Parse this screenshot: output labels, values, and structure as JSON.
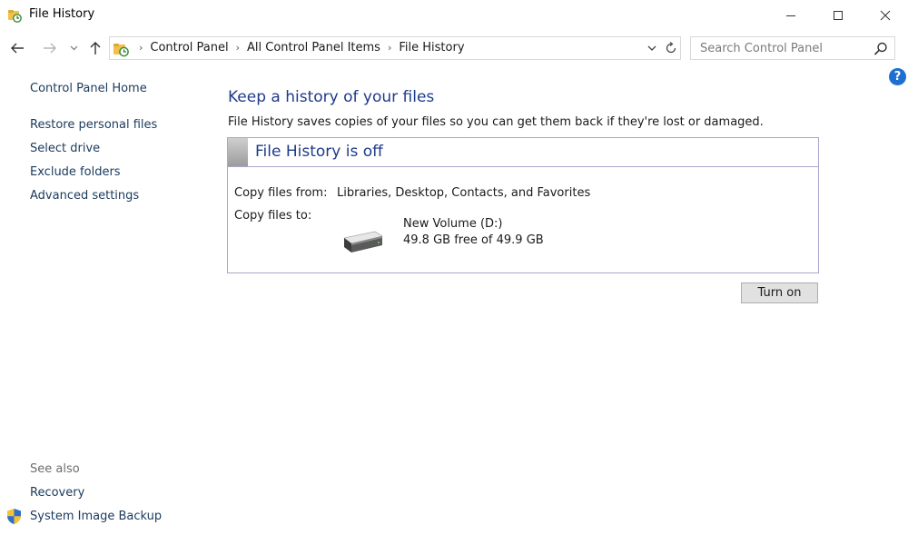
{
  "window": {
    "title": "File History",
    "controls": {
      "minimize_icon": "minimize-icon",
      "maximize_icon": "maximize-icon",
      "close_icon": "close-icon"
    }
  },
  "navigation": {
    "back_icon": "arrow-left-icon",
    "forward_icon": "arrow-right-icon",
    "recent_icon": "chevron-down-icon",
    "up_icon": "arrow-up-icon",
    "breadcrumbs": [
      "Control Panel",
      "All Control Panel Items",
      "File History"
    ],
    "refresh_icon": "refresh-icon",
    "search": {
      "placeholder": "Search Control Panel"
    }
  },
  "help_icon": "?",
  "sidebar": {
    "home_label": "Control Panel Home",
    "links": [
      "Restore personal files",
      "Select drive",
      "Exclude folders",
      "Advanced settings"
    ],
    "see_also_label": "See also",
    "see_also": [
      "Recovery",
      "System Image Backup"
    ]
  },
  "main": {
    "heading": "Keep a history of your files",
    "description": "File History saves copies of your files so you can get them back if they're lost or damaged.",
    "status": {
      "title": "File History is off",
      "copy_from_label": "Copy files from:",
      "copy_from_value": "Libraries, Desktop, Contacts, and Favorites",
      "copy_to_label": "Copy files to:",
      "drive_name": "New Volume (D:)",
      "drive_free": "49.8 GB free of 49.9 GB"
    },
    "turn_on_label": "Turn on"
  },
  "colors": {
    "heading_blue": "#1e3b8a",
    "link_color": "#1a3a5c",
    "panel_border": "#a9a7c9",
    "help_blue": "#1f6fd0"
  }
}
